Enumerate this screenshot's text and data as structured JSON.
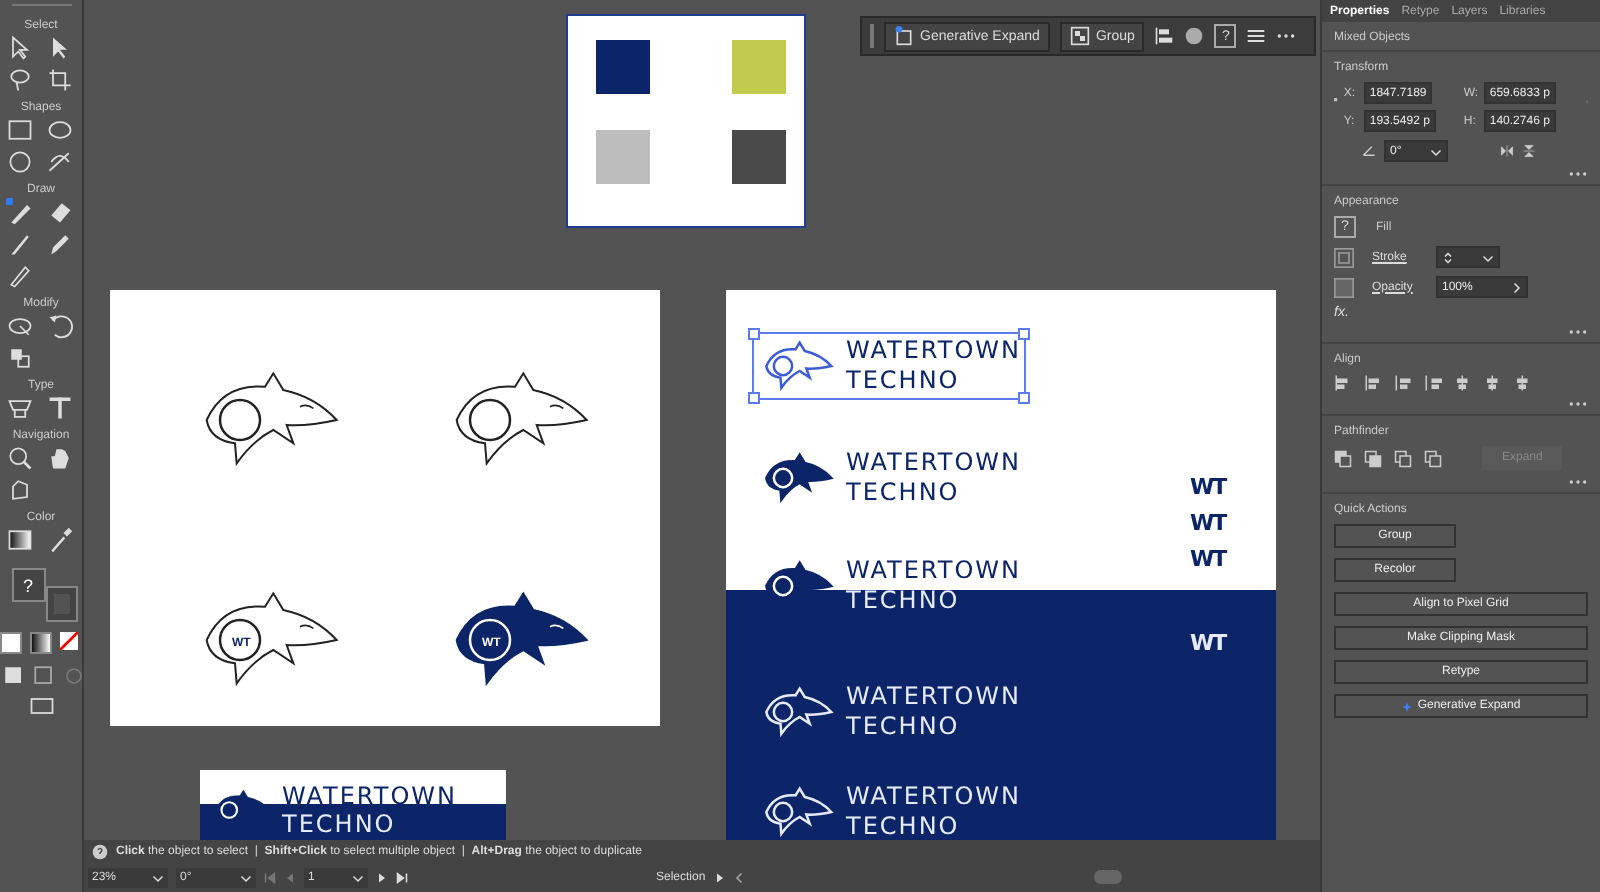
{
  "toolbar": {
    "sections": [
      {
        "label": "Select"
      },
      {
        "label": "Shapes"
      },
      {
        "label": "Draw"
      },
      {
        "label": "Modify"
      },
      {
        "label": "Type"
      },
      {
        "label": "Navigation"
      },
      {
        "label": "Color"
      }
    ],
    "fill_value": "?"
  },
  "context_bar": {
    "buttons": [
      {
        "label": "Generative Expand",
        "kind": "sparkle"
      },
      {
        "label": "Group",
        "kind": "group"
      }
    ],
    "help": "?"
  },
  "swatch_board": {
    "swatches": [
      {
        "color": "#0b2568"
      },
      {
        "color": "#c3cb4d"
      },
      {
        "color": "#bdbdbd"
      },
      {
        "color": "#4a4a4a"
      }
    ]
  },
  "shark_board": {
    "sharks": [
      {
        "kind": "outline"
      },
      {
        "kind": "outline"
      },
      {
        "kind": "outline",
        "monogram": "WT"
      },
      {
        "kind": "filled",
        "monogram": "WT"
      }
    ]
  },
  "logo_board": {
    "logos": [
      {
        "selected": true,
        "kind": "outline",
        "lines": [
          {
            "text": "WATERTOWN",
            "color": "#0b2568"
          },
          {
            "text": "TECHNO",
            "color": "#0b2568"
          }
        ]
      },
      {
        "selected": false,
        "kind": "filled",
        "lines": [
          {
            "text": "WATERTOWN",
            "color": "#0b2568"
          },
          {
            "text": "TECHNO",
            "color": "#0b2568"
          }
        ]
      },
      {
        "selected": false,
        "kind": "filled",
        "lines": [
          {
            "text": "WATERTOWN",
            "color": "#0b2568"
          },
          {
            "text": "TECHNO",
            "color": "#e6ebff"
          }
        ]
      },
      {
        "selected": false,
        "kind": "outline",
        "lines": [
          {
            "text": "WATERTOWN",
            "color": "#e6ebff"
          },
          {
            "text": "TECHNO",
            "color": "#e6ebff"
          }
        ]
      },
      {
        "selected": false,
        "kind": "outline",
        "lines": [
          {
            "text": "WATERTOWN",
            "color": "#e6ebff"
          },
          {
            "text": "TECHNO",
            "color": "#e6ebff"
          }
        ]
      }
    ],
    "monograms": [
      {
        "text": "WT",
        "color": "#0b2568"
      },
      {
        "text": "WT",
        "color": "#0b2568"
      },
      {
        "text": "WT",
        "color": "#0b2568"
      },
      {
        "text": "WT",
        "color": "#e6ebff"
      }
    ]
  },
  "small_board": {
    "lines": [
      {
        "text": "WATERTOWN",
        "color": "#0b2568"
      },
      {
        "text": "TECHNO",
        "color": "#e6ebff"
      }
    ]
  },
  "panel": {
    "tabs": [
      {
        "label": "Properties",
        "selected": true
      },
      {
        "label": "Retype",
        "selected": false
      },
      {
        "label": "Layers",
        "selected": false
      },
      {
        "label": "Libraries",
        "selected": false
      }
    ],
    "selection": "Mixed Objects",
    "transform": {
      "title": "Transform",
      "fields": [
        {
          "label": "X:",
          "value": "1847.7189"
        },
        {
          "label": "W:",
          "value": "659.6833 p"
        },
        {
          "label": "Y:",
          "value": "193.5492 p"
        },
        {
          "label": "H:",
          "value": "140.2746 p"
        }
      ],
      "angle": "0°"
    },
    "appearance": {
      "title": "Appearance",
      "fill_value": "?",
      "fill": "Fill",
      "stroke": "Stroke",
      "opacity": "Opacity",
      "opacity_value": "100%",
      "fx": "fx."
    },
    "align": {
      "title": "Align"
    },
    "pathfinder": {
      "title": "Pathfinder",
      "expand": {
        "label": "Expand",
        "disabled": true
      }
    },
    "quick_actions": {
      "title": "Quick Actions",
      "buttons": [
        {
          "label": "Group",
          "kind": "half"
        },
        {
          "label": "Recolor",
          "kind": "half"
        },
        {
          "label": "Align to Pixel Grid",
          "kind": "full"
        },
        {
          "label": "Make Clipping Mask",
          "kind": "full"
        },
        {
          "label": "Retype",
          "kind": "full"
        },
        {
          "label": "Generative Expand",
          "kind": "sparkle"
        }
      ]
    }
  },
  "status_bar": {
    "hint": "**Click** the object to select  |  **Shift+Click** to select multiple object  |  **Alt+Drag** the object to duplicate",
    "zoom": "23%",
    "rotation": "0°",
    "artboard": "1",
    "tool": "Selection"
  }
}
